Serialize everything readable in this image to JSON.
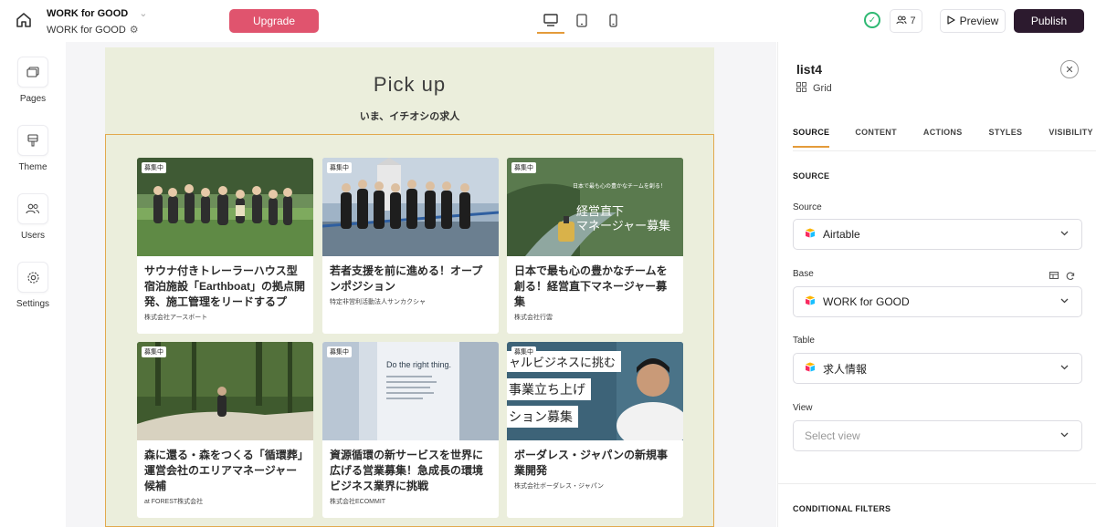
{
  "app": {
    "title": "WORK for GOOD",
    "subtitle": "WORK for GOOD"
  },
  "toolbar": {
    "upgrade_label": "Upgrade",
    "users_count": "7",
    "preview_label": "Preview",
    "publish_label": "Publish",
    "active_device": "desktop",
    "status_color": "#2eb872"
  },
  "sidebar": {
    "items": [
      {
        "label": "Pages",
        "icon": "pages-icon"
      },
      {
        "label": "Theme",
        "icon": "theme-icon"
      },
      {
        "label": "Users",
        "icon": "users-icon"
      },
      {
        "label": "Settings",
        "icon": "settings-icon"
      }
    ]
  },
  "canvas": {
    "heading": "Pick up",
    "subheading": "いま、イチオシの求人",
    "cards": [
      {
        "badge": "募集中",
        "title": "サウナ付きトレーラーハウス型宿泊施設「Earthboat」の拠点開発、施工管理をリードするプ",
        "company": "株式会社アースボート",
        "image": "team-photo-field"
      },
      {
        "badge": "募集中",
        "title": "若者支援を前に進める！オープンポジション",
        "company": "特定非営利活動法人サンカクシャ",
        "image": "team-photo-bridge"
      },
      {
        "badge": "募集中",
        "title": "日本で最も心の豊かなチームを創る！経営直下マネージャー募集",
        "company": "株式会社行雲",
        "image": "river-boat-banner",
        "banner_top": "日本で最も心の豊かなチームを創る！",
        "banner_main1": "経営直下",
        "banner_main2": "マネージャー募集"
      },
      {
        "badge": "募集中",
        "title": "森に還る・森をつくる「循環葬」運営会社のエリアマネージャー候補",
        "company": "at FOREST株式会社",
        "image": "forest-photo"
      },
      {
        "badge": "募集中",
        "title": "資源循環の新サービスを世界に広げる営業募集！急成長の環境ビジネス業界に挑戦",
        "company": "株式会社ECOMMIT",
        "image": "office-sign-photo",
        "sign_text": "Do the right thing."
      },
      {
        "badge": "募集中",
        "title": "ボーダレス・ジャパンの新規事業開発",
        "company": "株式会社ボーダレス・ジャパン",
        "image": "person-banner",
        "banner_lines": [
          "ャルビジネスに挑む",
          "事業立ち上げ",
          "ション募集"
        ]
      }
    ]
  },
  "panel": {
    "title": "list4",
    "type_label": "Grid",
    "tabs": [
      "SOURCE",
      "CONTENT",
      "ACTIONS",
      "STYLES",
      "VISIBILITY"
    ],
    "active_tab": "SOURCE",
    "section_title": "SOURCE",
    "source": {
      "label": "Source",
      "value": "Airtable"
    },
    "base": {
      "label": "Base",
      "value": "WORK for GOOD"
    },
    "table": {
      "label": "Table",
      "value": "求人情報"
    },
    "view": {
      "label": "View",
      "placeholder": "Select view"
    },
    "conditional_filters": "CONDITIONAL FILTERS"
  }
}
